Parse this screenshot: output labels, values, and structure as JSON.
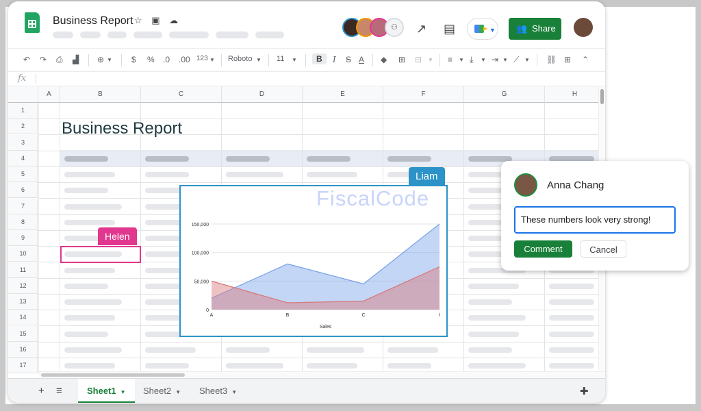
{
  "document": {
    "title": "Business Report",
    "title_icons": "☆ ▣ ☁",
    "sheet_heading": "Business Report"
  },
  "header": {
    "share_label": "Share",
    "share_icon": "people-icon",
    "collaborator_avatars": [
      "avatar-1",
      "avatar-2",
      "avatar-3"
    ],
    "more_collaborators_icon": "more-people-icon"
  },
  "toolbar": {
    "undo": "↶",
    "redo": "↷",
    "print": "⎙",
    "paint_format": "🖌",
    "zoom": "⊕",
    "currency": "$",
    "percent": "%",
    "decimal_decrease": ".0",
    "decimal_increase": ".00",
    "more_formats": "123",
    "font": "Roboto",
    "font_size": "11",
    "bold": "B",
    "italic": "I",
    "strikethrough": "S",
    "text_color": "A"
  },
  "formula_bar": {
    "fx": "fx"
  },
  "grid": {
    "columns": [
      "A",
      "B",
      "C",
      "D",
      "E",
      "F",
      "G",
      "H"
    ],
    "rows": [
      "1",
      "2",
      "3",
      "4",
      "5",
      "6",
      "7",
      "8",
      "9",
      "10",
      "11",
      "12",
      "13",
      "14",
      "15",
      "16",
      "17"
    ]
  },
  "collaborators": {
    "helen": {
      "name": "Helen",
      "color": "#e2378e"
    },
    "liam": {
      "name": "Liam",
      "color": "#2b93c7"
    }
  },
  "watermark": "FiscalCode",
  "chart_data": {
    "type": "area",
    "categories": [
      "A",
      "B",
      "C",
      "I"
    ],
    "xlabel": "Sales",
    "ylabel": "",
    "ylim": [
      0,
      150000
    ],
    "y_ticks": [
      "0",
      "50,000",
      "100,000",
      "150,000"
    ],
    "series": [
      {
        "values": [
          20000,
          80000,
          45000,
          150000
        ],
        "color": "#7ba4e8"
      },
      {
        "values": [
          50000,
          12000,
          15000,
          75000
        ],
        "color": "#d9777a"
      }
    ]
  },
  "comment": {
    "author": "Anna Chang",
    "text": "These numbers look very strong!",
    "submit_label": "Comment",
    "cancel_label": "Cancel"
  },
  "sheets": {
    "tabs": [
      {
        "label": "Sheet1",
        "active": true
      },
      {
        "label": "Sheet2",
        "active": false
      },
      {
        "label": "Sheet3",
        "active": false
      }
    ],
    "add_icon": "+",
    "list_icon": "≡"
  }
}
